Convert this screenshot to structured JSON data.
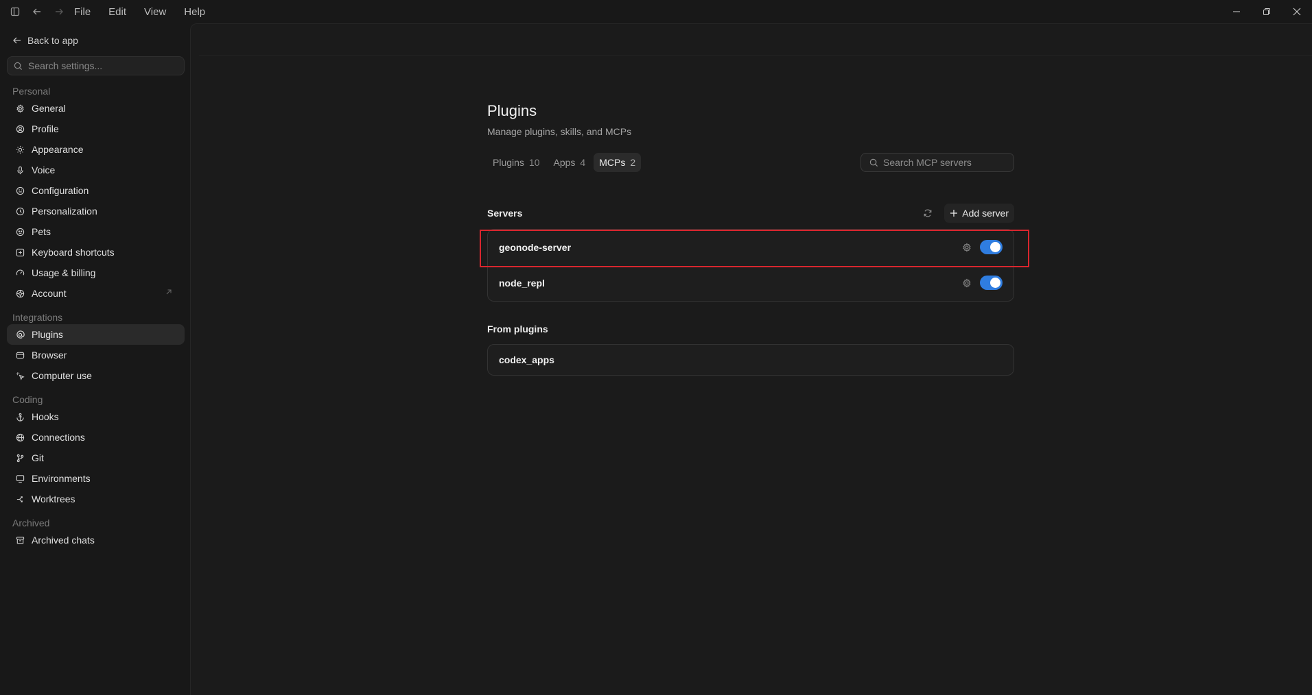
{
  "menu": [
    "File",
    "Edit",
    "View",
    "Help"
  ],
  "sidebar": {
    "back_label": "Back to app",
    "search_placeholder": "Search settings...",
    "sections": {
      "personal": "Personal",
      "integrations": "Integrations",
      "coding": "Coding",
      "archived": "Archived"
    },
    "personal_items": [
      {
        "label": "General",
        "icon": "gear-icon"
      },
      {
        "label": "Profile",
        "icon": "user-circle-icon"
      },
      {
        "label": "Appearance",
        "icon": "sun-icon"
      },
      {
        "label": "Voice",
        "icon": "microphone-icon"
      },
      {
        "label": "Configuration",
        "icon": "sliders-icon"
      },
      {
        "label": "Personalization",
        "icon": "sparkle-icon"
      },
      {
        "label": "Pets",
        "icon": "paw-icon"
      },
      {
        "label": "Keyboard shortcuts",
        "icon": "keyboard-icon"
      },
      {
        "label": "Usage & billing",
        "icon": "gauge-icon"
      },
      {
        "label": "Account",
        "icon": "settings-cog-icon"
      }
    ],
    "integrations_items": [
      {
        "label": "Plugins",
        "icon": "at-icon",
        "active": true
      },
      {
        "label": "Browser",
        "icon": "browser-window-icon"
      },
      {
        "label": "Computer use",
        "icon": "cursor-click-icon"
      }
    ],
    "coding_items": [
      {
        "label": "Hooks",
        "icon": "anchor-icon"
      },
      {
        "label": "Connections",
        "icon": "globe-icon"
      },
      {
        "label": "Git",
        "icon": "git-branch-icon"
      },
      {
        "label": "Environments",
        "icon": "monitor-icon"
      },
      {
        "label": "Worktrees",
        "icon": "branch-tree-icon"
      }
    ],
    "archived_items": [
      {
        "label": "Archived chats",
        "icon": "archive-box-icon"
      }
    ]
  },
  "main": {
    "title": "Plugins",
    "subtitle": "Manage plugins, skills, and MCPs",
    "tabs": [
      {
        "label": "Plugins",
        "count": "10"
      },
      {
        "label": "Apps",
        "count": "4"
      },
      {
        "label": "MCPs",
        "count": "2",
        "active": true
      }
    ],
    "search_placeholder": "Search MCP servers",
    "servers_label": "Servers",
    "add_server_label": "Add server",
    "servers": [
      {
        "name": "geonode-server",
        "enabled": true,
        "highlighted": true
      },
      {
        "name": "node_repl",
        "enabled": true
      }
    ],
    "from_plugins_label": "From plugins",
    "plugin_servers": [
      {
        "name": "codex_apps"
      }
    ]
  },
  "colors": {
    "toggle_on": "#2f7de0",
    "highlight_box": "#d9262e"
  }
}
